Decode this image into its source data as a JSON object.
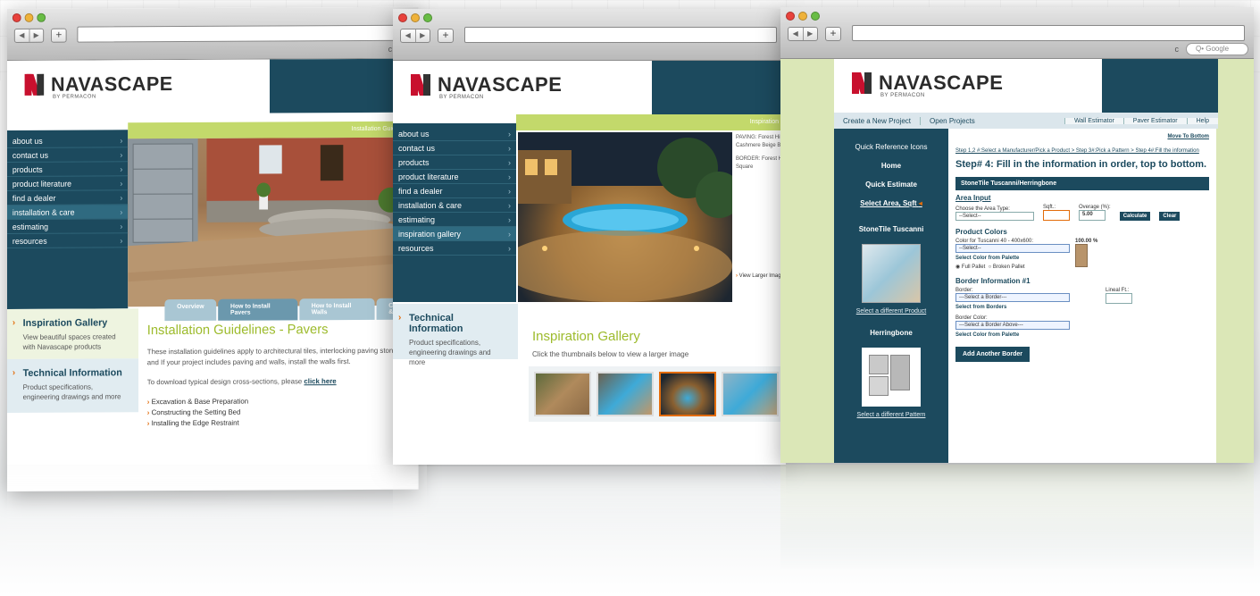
{
  "common": {
    "brand": "NAVASCAPE",
    "brand_sub": "BY PERMACON",
    "search_placeholder": "Q• Google",
    "reload_icon": "c"
  },
  "screen1": {
    "nav": [
      "about us",
      "contact us",
      "products",
      "product literature",
      "find a dealer",
      "installation & care",
      "estimating",
      "resources"
    ],
    "active_nav": 5,
    "strip_label": "Installation Guidelines",
    "tabs": [
      "Overview",
      "How to Install Pavers",
      "How to Install Walls",
      "Care &"
    ],
    "side_boxes": [
      {
        "title": "Inspiration Gallery",
        "text": "View beautiful spaces created with Navascape products"
      },
      {
        "title": "Technical Information",
        "text": "Product specifications, engineering drawings and more"
      }
    ],
    "heading": "Installation Guidelines - Pavers",
    "para1": "These installation guidelines apply to architectural tiles, interlocking paving stones and If your project includes paving and walls, install the walls first.",
    "para2_prefix": "To download typical design cross-sections, please ",
    "para2_link": "click here",
    "bullets": [
      "Excavation & Base Preparation",
      "Constructing the Setting Bed",
      "Installing the Edge Restraint"
    ]
  },
  "screen2": {
    "nav": [
      "about us",
      "contact us",
      "products",
      "product literature",
      "find a dealer",
      "installation & care",
      "estimating",
      "inspiration gallery",
      "resources"
    ],
    "active_nav": 7,
    "strip_label": "Inspiration",
    "side_box": {
      "title": "Technical Information",
      "text": "Product specifications, engineering drawings and more"
    },
    "caption_1": "PAVING: Forest Hill",
    "caption_2": "Cashmere Beige Ble",
    "caption_3": "BORDER: Forest Hi",
    "caption_4": "Square",
    "view_larger": "View Larger Imag",
    "heading": "Inspiration Gallery",
    "subtext": "Click the thumbnails below to view a larger image"
  },
  "screen3": {
    "top_tabs": [
      "Create a New Project",
      "Open Projects"
    ],
    "right_tabs": [
      "Wall Estimator",
      "Paver Estimator",
      "Help"
    ],
    "side": {
      "quick_ref": "Quick Reference Icons",
      "home": "Home",
      "quick_est": "Quick Estimate",
      "select_area": "Select Area, Sqft",
      "product_name": "StoneTile Tuscanni",
      "select_product": "Select a different Product",
      "pattern_name": "Herringbone",
      "select_pattern": "Select a different Pattern"
    },
    "move_bottom": "Move To Bottom",
    "breadcrumb": "Step 1,2 #:Select a Manufacturer/Pick a Product > Step 3#:Pick a Pattern > Step 4#:Fill the information",
    "step_head": "Step# 4: Fill in the information in order, top to bottom.",
    "bar_head": "StoneTile Tuscanni/Herringbone",
    "area_input": "Area Input",
    "choose_area": "Choose the Area Type:",
    "select_default": "--Select--",
    "sqft_label": "Sqft.:",
    "overage_label": "Overage (%):",
    "overage_val": "5.00",
    "calc": "Calculate",
    "clear": "Clear",
    "product_colors": "Product Colors",
    "color_for": "Color for Tuscanni 40 - 400x600:",
    "percent": "100.00 %",
    "select_color": "Select Color from Palette",
    "full_pallet": "Full Pallet",
    "broken_pallet": "Broken Pallet",
    "border_info": "Border Information #1",
    "border_label": "Border:",
    "select_border": "---Select a Border---",
    "select_from_borders": "Select from Borders",
    "lineal": "Lineal Ft.:",
    "border_color": "Border Color:",
    "select_border_above": "---Select a Border Above---",
    "add_border": "Add Another Border"
  }
}
